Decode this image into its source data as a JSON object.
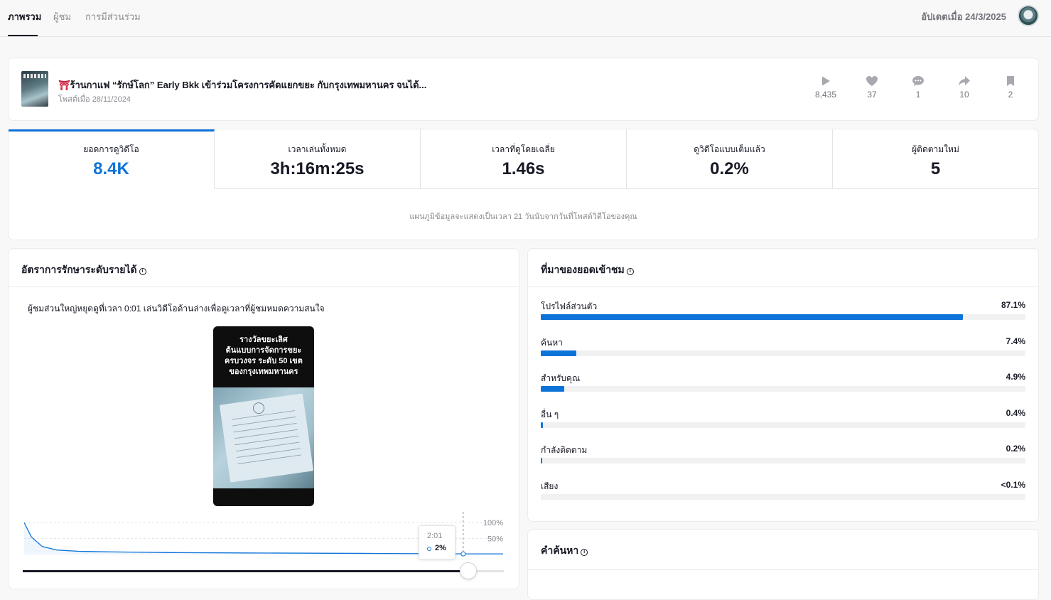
{
  "nav": {
    "tabs": [
      {
        "label": "ภาพรวม",
        "active": true
      },
      {
        "label": "ผู้ชม",
        "active": false
      },
      {
        "label": "การมีส่วนร่วม",
        "active": false
      }
    ],
    "updated": "อัปเดตเมื่อ 24/3/2025"
  },
  "post": {
    "title": "ร้านกาแฟ “รักษ์โลก” Early Bkk เข้าร่วมโครงการคัดแยกขยะ กับกรุงเทพมหานคร จนได้...",
    "title_emoji": "⛩",
    "date": "โพสต์เมื่อ 28/11/2024",
    "stats": [
      {
        "icon": "play-icon",
        "value": "8,435"
      },
      {
        "icon": "heart-icon",
        "value": "37"
      },
      {
        "icon": "comment-icon",
        "value": "1"
      },
      {
        "icon": "share-icon",
        "value": "10"
      },
      {
        "icon": "bookmark-icon",
        "value": "2"
      }
    ]
  },
  "metrics": [
    {
      "label": "ยอดการดูวิดีโอ",
      "value": "8.4K"
    },
    {
      "label": "เวลาเล่นทั้งหมด",
      "value": "3h:16m:25s"
    },
    {
      "label": "เวลาที่ดูโดยเฉลี่ย",
      "value": "1.46s"
    },
    {
      "label": "ดูวิดีโอแบบเต็มแล้ว",
      "value": "0.2%"
    },
    {
      "label": "ผู้ติดตามใหม่",
      "value": "5"
    }
  ],
  "chart_note": "แผนภูมิข้อมูลจะแสดงเป็นเวลา 21 วันนับจากวันที่โพสต์วิดีโอของคุณ",
  "retention": {
    "title": "อัตราการรักษาระดับรายได้",
    "info": "i",
    "description": "ผู้ชมส่วนใหญ่หยุดดูที่เวลา 0:01 เล่นวิดีโอด้านล่างเพื่อดูเวลาที่ผู้ชมหมดความสนใจ",
    "video_caption": [
      "รางวัลขยะเลิศ",
      "ต้นแบบการจัดการขยะ",
      "ครบวงจร ระดับ 50 เขต",
      "ของกรุงเทพมหานคร"
    ],
    "tooltip_time": "2:01",
    "tooltip_value": "2%",
    "slider_position": 0.925
  },
  "traffic": {
    "title": "ที่มาของยอดเข้าชม",
    "info": "i",
    "sources": [
      {
        "name": "โปรไฟล์ส่วนตัว",
        "pct": "87.1%",
        "fraction": 0.871
      },
      {
        "name": "ค้นหา",
        "pct": "7.4%",
        "fraction": 0.074
      },
      {
        "name": "สำหรับคุณ",
        "pct": "4.9%",
        "fraction": 0.049
      },
      {
        "name": "อื่น ๆ",
        "pct": "0.4%",
        "fraction": 0.004
      },
      {
        "name": "กำลังติดตาม",
        "pct": "0.2%",
        "fraction": 0.002
      },
      {
        "name": "เสียง",
        "pct": "<0.1%",
        "fraction": 0.0
      }
    ]
  },
  "search_terms": {
    "title": "คำค้นหา",
    "info": "i"
  },
  "chart_data": {
    "type": "line",
    "title": "",
    "xlabel": "",
    "ylabel": "",
    "y_ticks": [
      "100%",
      "50%"
    ],
    "ylim": [
      0,
      100
    ],
    "xlim_seconds": [
      0,
      132
    ],
    "x": [
      0,
      2,
      5,
      9,
      15,
      25,
      40,
      60,
      80,
      100,
      121,
      132
    ],
    "values": [
      100,
      55,
      25,
      14,
      10,
      8,
      6,
      5,
      4,
      3,
      2,
      2
    ],
    "highlight": {
      "x": 121,
      "label": "2:01",
      "value": "2%"
    },
    "color": "#0e73d8"
  },
  "colors": {
    "accent": "#0e73d8",
    "text": "#161823",
    "muted": "#8a8b91"
  }
}
